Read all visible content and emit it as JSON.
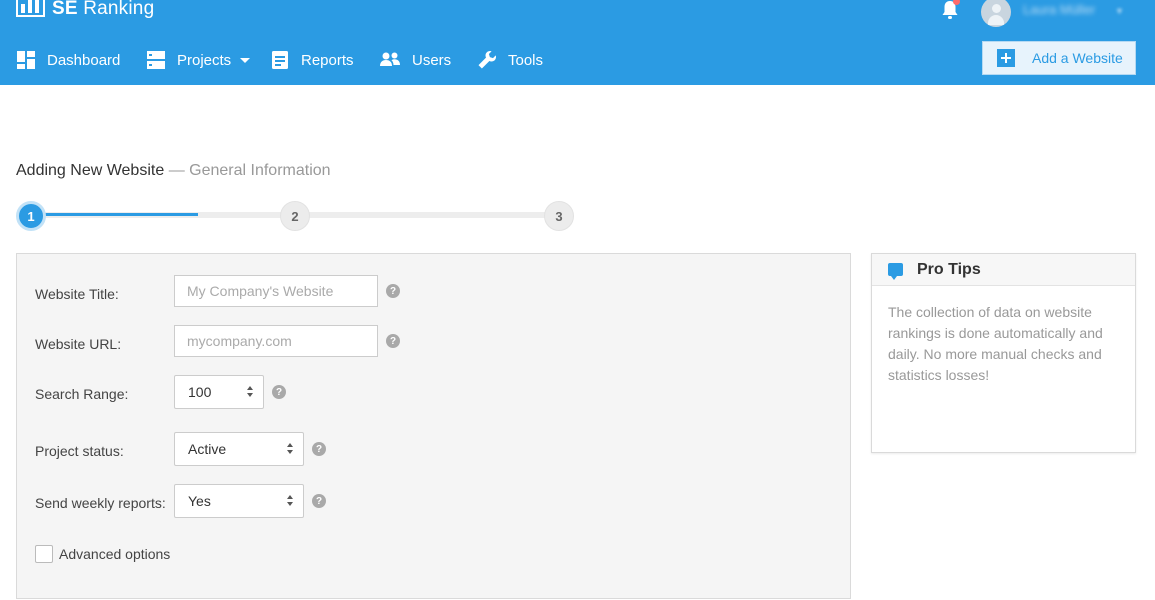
{
  "brand": {
    "name_bold": "SE",
    "name_rest": " Ranking",
    "accent": "#2b9be3"
  },
  "user": {
    "name": "Laura Müller"
  },
  "nav": {
    "items": [
      {
        "label": "Dashboard",
        "icon": "dashboard-icon"
      },
      {
        "label": "Projects",
        "icon": "projects-icon",
        "has_dropdown": true
      },
      {
        "label": "Reports",
        "icon": "reports-icon"
      },
      {
        "label": "Users",
        "icon": "users-icon"
      },
      {
        "label": "Tools",
        "icon": "wrench-icon"
      }
    ],
    "add_website_label": "Add a Website"
  },
  "page": {
    "title": "Adding New Website",
    "subtitle": "— General Information"
  },
  "steps": {
    "items": [
      "1",
      "2",
      "3"
    ],
    "current": 1
  },
  "form": {
    "website_title": {
      "label": "Website Title:",
      "placeholder": "My Company's Website"
    },
    "website_url": {
      "label": "Website URL:",
      "placeholder": "mycompany.com"
    },
    "search_range": {
      "label": "Search Range:",
      "value": "100"
    },
    "project_status": {
      "label": "Project status:",
      "value": "Active"
    },
    "weekly_reports": {
      "label": "Send weekly reports:",
      "value": "Yes"
    },
    "advanced_options": {
      "label": "Advanced options",
      "checked": false
    },
    "help_glyph": "?"
  },
  "tips": {
    "title": "Pro Tips",
    "text": "The collection of data on website rankings is done automatically and daily. No more manual checks and statistics losses!"
  }
}
